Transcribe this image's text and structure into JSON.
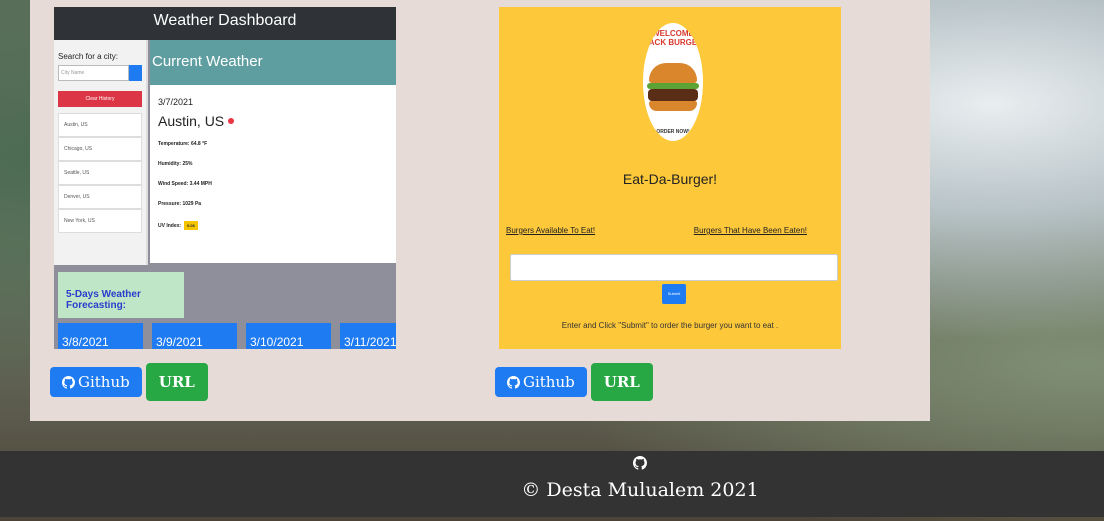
{
  "projects": [
    {
      "github_label": "Github",
      "url_label": "URL",
      "thumbnail": {
        "title": "Weather Dashboard",
        "search_label": "Search for a city:",
        "search_placeholder": "City Name",
        "clear_label": "Clear History",
        "cities": [
          "Austin, US",
          "Chicago, US",
          "Seattle, US",
          "Denver, US",
          "New York, US"
        ],
        "current_header": "Current Weather",
        "date": "3/7/2021",
        "city": "Austin, US",
        "temperature": "Temperature: 64.8 °F",
        "humidity": "Humidity: 25%",
        "wind": "Wind Speed: 3.44 MPH",
        "pressure": "Pressure: 1029 Pa",
        "uv_label": "UV Index:",
        "uv_value": "0.06",
        "forecast_label": "5-Days Weather Forecasting:",
        "forecast_days": [
          "3/8/2021",
          "3/9/2021",
          "3/10/2021",
          "3/11/2021"
        ]
      }
    },
    {
      "github_label": "Github",
      "url_label": "URL",
      "thumbnail": {
        "logo_text": "WELCOME BACK BURGER",
        "order_text": "ORDER NOW!",
        "title": "Eat-Da-Burger!",
        "available_label": "Burgers Available To Eat!",
        "eaten_label": "Burgers That Have Been Eaten!",
        "submit_label": "Submit",
        "hint": "Enter and Click \"Submit\" to order the burger you want to eat ."
      }
    }
  ],
  "footer": {
    "icon": "github-icon",
    "copyright": "© Desta Mulualem 2021"
  }
}
